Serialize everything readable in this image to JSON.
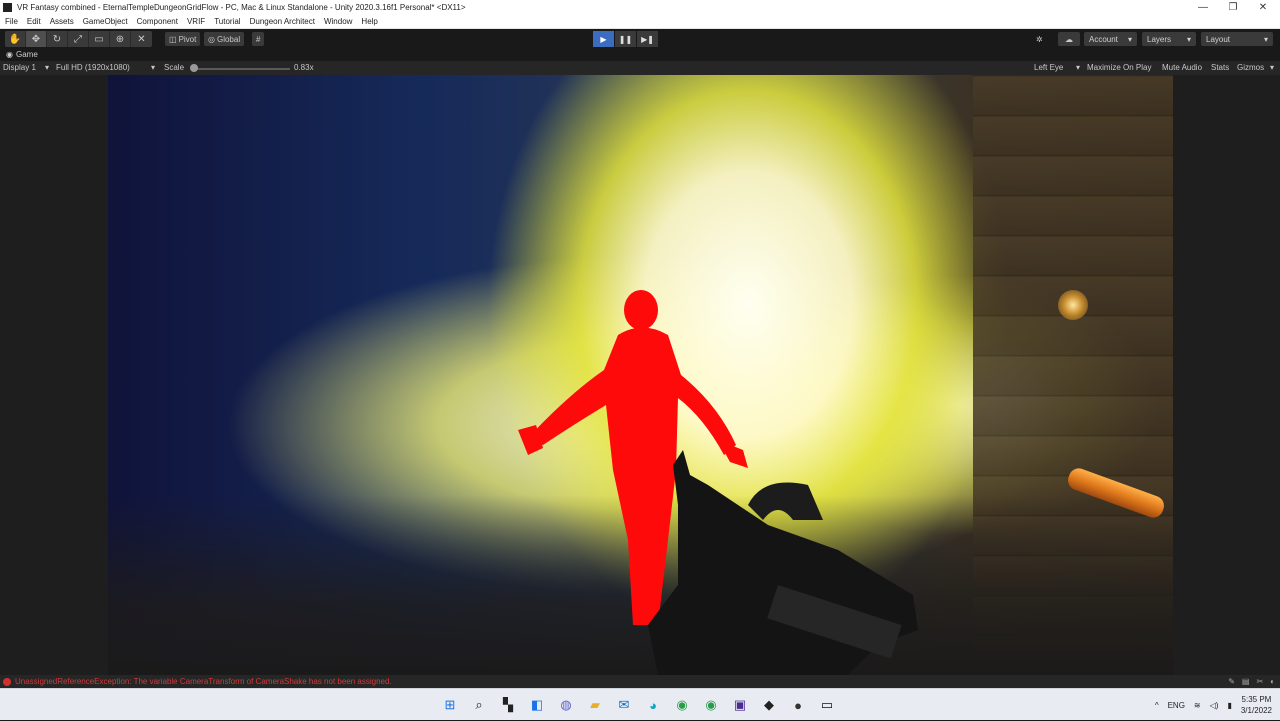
{
  "window": {
    "title": "VR Fantasy combined - EternalTempleDungeonGridFlow - PC, Mac & Linux Standalone - Unity 2020.3.16f1 Personal* <DX11>",
    "minimize_glyph": "—",
    "maximize_glyph": "❐",
    "close_glyph": "✕"
  },
  "menu": [
    "File",
    "Edit",
    "Assets",
    "GameObject",
    "Component",
    "VRIF",
    "Tutorial",
    "Dungeon Architect",
    "Window",
    "Help"
  ],
  "toolbar": {
    "tools": [
      {
        "icon": "hand-icon",
        "glyph": "✋"
      },
      {
        "icon": "move-icon",
        "glyph": "✥"
      },
      {
        "icon": "rotate-icon",
        "glyph": "↻"
      },
      {
        "icon": "scale-icon",
        "glyph": "⤢"
      },
      {
        "icon": "rect-icon",
        "glyph": "▭"
      },
      {
        "icon": "transform-icon",
        "glyph": "⊕"
      },
      {
        "icon": "custom-tool-icon",
        "glyph": "✕"
      }
    ],
    "pivot_label": "Pivot",
    "global_label": "Global",
    "grid_glyph": "#",
    "play_glyph": "▶",
    "pause_glyph": "❚❚",
    "step_glyph": "▶❚",
    "collab_glyph": "✲",
    "cloud_glyph": "☁",
    "account_label": "Account",
    "layers_label": "Layers",
    "layout_label": "Layout",
    "dropdown_glyph": "▾"
  },
  "game_tab": {
    "label": "Game",
    "icon_glyph": "◉"
  },
  "game_toolbar": {
    "display": "Display 1",
    "resolution": "Full HD (1920x1080)",
    "scale_label": "Scale",
    "scale_value": "0.83x",
    "eye": "Left Eye",
    "maximize_on_play": "Maximize On Play",
    "mute_audio": "Mute Audio",
    "stats": "Stats",
    "gizmos": "Gizmos",
    "more_glyph": "⋮"
  },
  "status": {
    "error": "UnassignedReferenceException: The variable CameraTransform of CameraShake has not been assigned.",
    "icons": [
      "✎",
      "▤",
      "✂",
      "◐"
    ]
  },
  "taskbar": {
    "apps": [
      {
        "name": "windows-start-icon",
        "glyph": "⊞",
        "color": "#1a73e8"
      },
      {
        "name": "search-icon",
        "glyph": "⌕",
        "color": "#222222"
      },
      {
        "name": "task-view-icon",
        "glyph": "▚",
        "color": "#222222"
      },
      {
        "name": "widgets-icon",
        "glyph": "◧",
        "color": "#1a73e8"
      },
      {
        "name": "chat-icon",
        "glyph": "◍",
        "color": "#5b5fc7"
      },
      {
        "name": "file-explorer-icon",
        "glyph": "▰",
        "color": "#e6b028"
      },
      {
        "name": "mail-icon",
        "glyph": "✉",
        "color": "#0f6cbd"
      },
      {
        "name": "edge-icon",
        "glyph": "◕",
        "color": "#0fa4c7"
      },
      {
        "name": "chrome-icon",
        "glyph": "◉",
        "color": "#2a9d4b"
      },
      {
        "name": "chrome-dev-icon",
        "glyph": "◉",
        "color": "#2a9d4b"
      },
      {
        "name": "visual-studio-icon",
        "glyph": "▣",
        "color": "#4b2b8f"
      },
      {
        "name": "unity-icon",
        "glyph": "◆",
        "color": "#222222"
      },
      {
        "name": "app-icon",
        "glyph": "●",
        "color": "#333333"
      },
      {
        "name": "oculus-icon",
        "glyph": "▭",
        "color": "#111111"
      }
    ],
    "tray_up": "^",
    "lang": "ENG",
    "wifi_glyph": "≋",
    "speaker_glyph": "◁)",
    "battery_glyph": "▮",
    "time": "5:35 PM",
    "date": "3/1/2022"
  }
}
